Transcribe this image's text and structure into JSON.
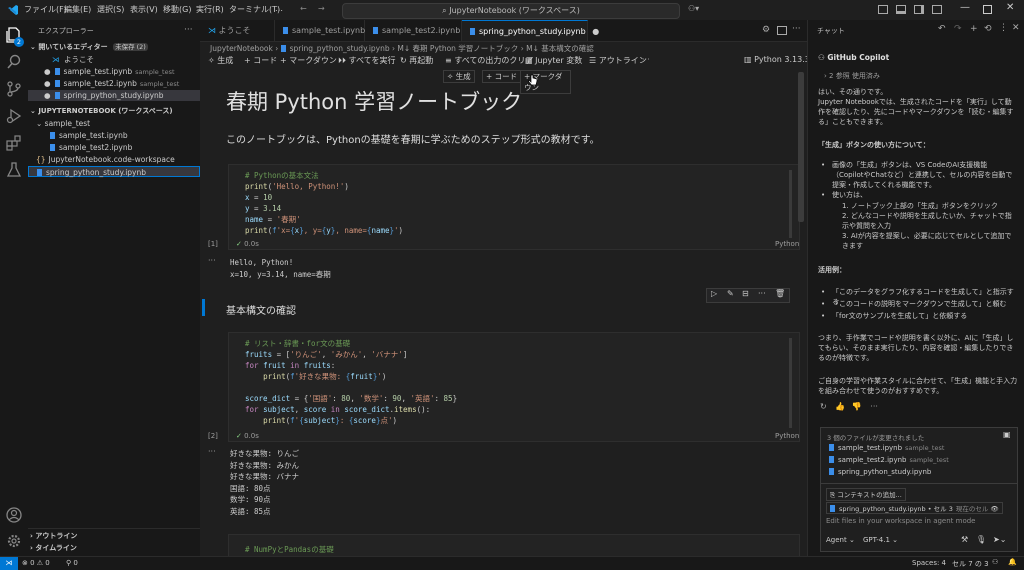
{
  "titlebar": {
    "menus": [
      "ファイル(F)",
      "編集(E)",
      "選択(S)",
      "表示(V)",
      "移動(G)",
      "実行(R)",
      "ターミナル(T)",
      "…"
    ],
    "search": "JupyterNotebook (ワークスペース)"
  },
  "activity": {
    "badge": "2"
  },
  "sidebar": {
    "title": "エクスプローラー",
    "open_editors": "開いているエディター",
    "unsaved_badge": "未保存 (2)",
    "open_items": [
      {
        "name": "ようこそ",
        "sub": ""
      },
      {
        "name": "sample_test.ipynb",
        "sub": "sample_test"
      },
      {
        "name": "sample_test2.ipynb",
        "sub": "sample_test"
      },
      {
        "name": "spring_python_study.ipynb",
        "sub": ""
      }
    ],
    "workspace": "JUPYTERNOTEBOOK (ワークスペース)",
    "tree": [
      "sample_test",
      "sample_test.ipynb",
      "sample_test2.ipynb",
      "JupyterNotebook.code-workspace",
      "spring_python_study.ipynb"
    ],
    "outline": "アウトライン",
    "timeline": "タイムライン"
  },
  "tabs": [
    "ようこそ",
    "sample_test.ipynb",
    "sample_test2.ipynb",
    "spring_python_study.ipynb"
  ],
  "breadcrumb": [
    "JupyterNotebook",
    "spring_python_study.ipynb",
    "M↓ 春期 Python 学習ノートブック",
    "M↓ 基本構文の確認"
  ],
  "toolbar": {
    "generate": "生成",
    "code": "コード",
    "markdown": "マークダウン",
    "run_all": "すべてを実行",
    "restart": "再起動",
    "clear_outputs": "すべての出力のクリア",
    "jupyter_vars": "Jupyter 変数",
    "outline": "アウトライン",
    "kernel": "Python 3.13.3"
  },
  "insert_bar": {
    "generate": "生成",
    "code": "コード",
    "markdown": "マークダウン"
  },
  "notebook": {
    "title": "春期 Python 学習ノートブック",
    "intro": "このノートブックは、Pythonの基礎を春期に学ぶためのステップ形式の教材です。",
    "cell1": {
      "lines": [
        "# Pythonの基本文法",
        "print('Hello, Python!')",
        "x = 10",
        "y = 3.14",
        "name = '春期'",
        "print(f'x={x}, y={y}, name={name}')"
      ],
      "exec": "[1]",
      "time": "0.0s",
      "lang": "Python",
      "output": [
        "Hello, Python!",
        "x=10, y=3.14, name=春期"
      ]
    },
    "section": "基本構文の確認",
    "cell2": {
      "lines": [
        "# リスト・辞書・for文の基礎",
        "fruits = ['りんご', 'みかん', 'バナナ']",
        "for fruit in fruits:",
        "    print(f'好きな果物: {fruit}')",
        "",
        "score_dict = {'国語': 80, '数学': 90, '英語': 85}",
        "for subject, score in score_dict.items():",
        "    print(f'{subject}: {score}点')"
      ],
      "exec": "[2]",
      "time": "0.0s",
      "lang": "Python",
      "output": [
        "好きな果物: りんご",
        "好きな果物: みかん",
        "好きな果物: バナナ",
        "国語: 80点",
        "数学: 90点",
        "英語: 85点"
      ]
    },
    "cell3": {
      "lines": [
        "# NumPyとPandasの基礎"
      ]
    }
  },
  "chat": {
    "header": "チャット",
    "agent": "GitHub Copilot",
    "refs": "2 参照 使用済み",
    "p1": "はい、その通りです。",
    "p2": "Jupyter Notebookでは、生成されたコードを「実行」して動作を確認したり、先にコードやマークダウンを「読む・編集する」こともできます。",
    "heading": "「生成」ボタンの使い方について：",
    "b1": "画像の「生成」ボタンは、VS CodeのAI支援機能（CopilotやChatなど）と連携して、セルの内容を自動で提案・作成してくれる機能です。",
    "b2": "使い方は、",
    "steps": [
      "1. ノートブック上部の「生成」ボタンをクリック",
      "2. どんなコードや説明を生成したいか、チャットで指示や質問を入力",
      "3. AIが内容を提案し、必要に応じてセルとして追加できます"
    ],
    "examples_h": "活用例：",
    "examples": [
      "「このデータをグラフ化するコードを生成して」と指示する",
      "「このコードの説明をマークダウンで生成して」と頼む",
      "「for文のサンプルを生成して」と依頼する"
    ],
    "p3": "つまり、手作業でコードや説明を書く以外に、AIに「生成」してもらい、そのまま実行したり、内容を確認・編集したりできるのが特徴です。",
    "p4": "ご自身の学習や作業スタイルに合わせて、「生成」機能と手入力を組み合わせて使うのがおすすめです。",
    "changed": "3 個のファイルが変更されました",
    "files": [
      {
        "name": "sample_test.ipynb",
        "sub": "sample_test"
      },
      {
        "name": "sample_test2.ipynb",
        "sub": "sample_test"
      },
      {
        "name": "spring_python_study.ipynb",
        "sub": ""
      }
    ],
    "add_context": "コンテキストの追加...",
    "context_chip": "spring_python_study.ipynb • セル 3",
    "context_sub": "現在のセル",
    "placeholder": "Edit files in your workspace in agent mode",
    "mode": "Agent",
    "model": "GPT-4.1"
  },
  "status": {
    "problems": "0 ⚠ 0",
    "ports": "0",
    "spaces": "Spaces: 4",
    "cell": "セル 7 の 3"
  }
}
